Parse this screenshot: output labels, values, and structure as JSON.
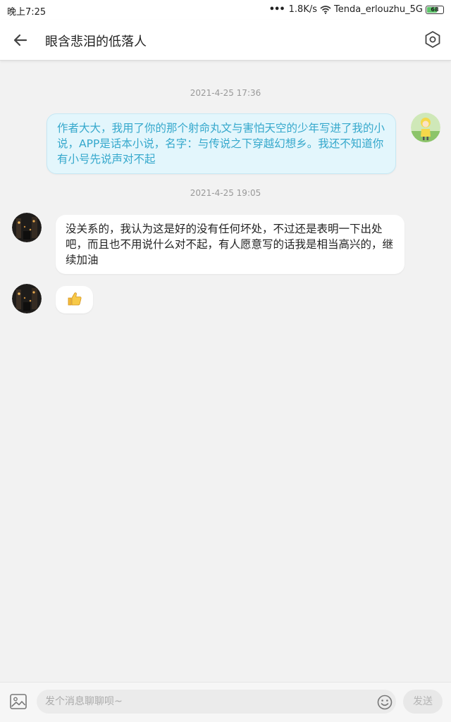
{
  "status_bar": {
    "time": "晚上7:25",
    "network_speed": "1.8K/s",
    "wifi_name": "Tenda_erlouzhu_5G",
    "battery_level": "68",
    "battery_fraction": 0.68
  },
  "header": {
    "back_icon": "arrow-left-icon",
    "title": "眼含悲泪的低落人",
    "settings_icon": "hexagon-settings-icon"
  },
  "messages": [
    {
      "timestamp": "2021-4-25 17:36",
      "direction": "outgoing",
      "text": "作者大大，我用了你的那个射命丸文与害怕天空的少年写进了我的小说，APP是话本小说，名字：与传说之下穿越幻想乡。我还不知道你有小号先说声对不起"
    },
    {
      "timestamp": "2021-4-25 19:05",
      "direction": "incoming",
      "text": "没关系的，我认为这是好的没有任何坏处，不过还是表明一下出处吧，而且也不用说什么对不起，有人愿意写的话我是相当高兴的，继续加油"
    },
    {
      "direction": "incoming",
      "emoji": "👍",
      "icon": "thumbs-up-icon"
    }
  ],
  "input_bar": {
    "image_icon": "image-icon",
    "placeholder": "发个消息聊聊呗~",
    "value": "",
    "emoji_icon": "smiley-icon",
    "send_label": "发送"
  },
  "colors": {
    "background": "#f2f2f2",
    "outgoing_bubble_bg": "#e3f6fc",
    "outgoing_text": "#35a8cc",
    "incoming_bubble_bg": "#ffffff",
    "timestamp_text": "#999999",
    "battery_green": "#5cc46a"
  }
}
